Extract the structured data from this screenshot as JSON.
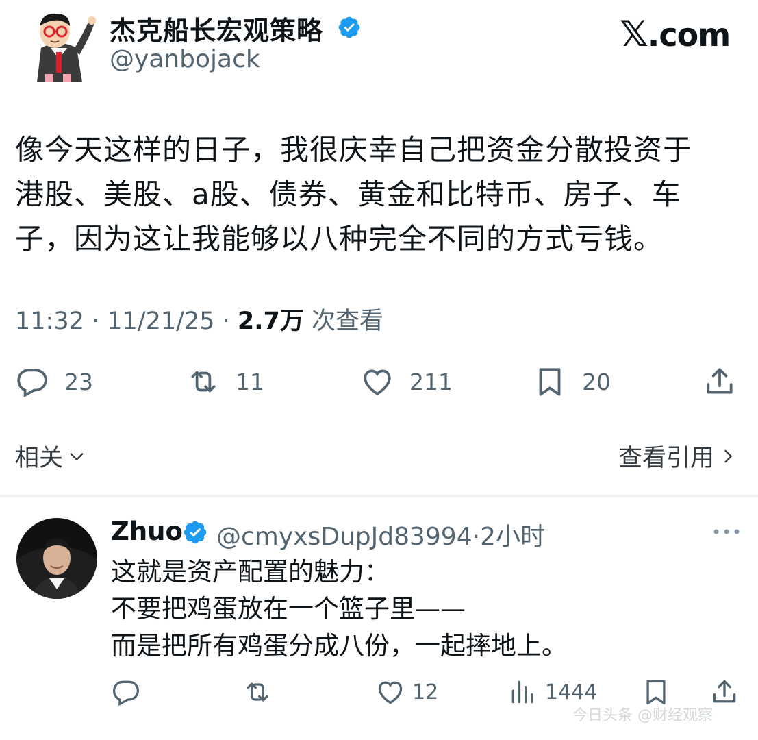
{
  "tweet": {
    "author_name": "杰克船长宏观策略",
    "author_handle": "@yanbojack",
    "source_logo_mark": "𝕏",
    "source_logo_text": ".com",
    "body_lines": [
      "像今天这样的日子，我很庆幸自己把资金分散投资于",
      "港股、美股、a股、债券、黄金和比特币、房子、车",
      "子，因为这让我能够以八种完全不同的方式亏钱。"
    ],
    "time": "11:32",
    "date": "11/21/25",
    "views_count": "2.7万",
    "views_label": "次查看",
    "meta_sep": " · ",
    "actions": {
      "replies": "23",
      "retweets": "11",
      "likes": "211",
      "bookmarks": "20"
    },
    "related_label": "相关",
    "quotes_label": "查看引用"
  },
  "reply": {
    "author_name": "Zhuo",
    "author_handle": "@cmyxsDupJd83994",
    "time_ago": "2小时",
    "meta_sep": "·",
    "body_lines": [
      "这就是资产配置的魅力：",
      "不要把鸡蛋放在一个篮子里——",
      "而是把所有鸡蛋分成八份，一起摔地上。"
    ],
    "actions": {
      "likes": "12",
      "views": "1444"
    }
  },
  "watermark": "今日头条 @财经观察",
  "icons": {
    "verified": "verified-badge-icon",
    "reply": "reply-bubble-icon",
    "retweet": "retweet-arrows-icon",
    "like": "heart-icon",
    "bookmark": "bookmark-icon",
    "share": "share-upload-icon",
    "views": "bar-chart-icon",
    "more": "ellipsis-icon",
    "chevron_down": "chevron-down-icon",
    "chevron_right": "chevron-right-icon"
  },
  "colors": {
    "text": "#0f1419",
    "muted": "#536471",
    "verified": "#1d9bf0",
    "divider": "#eff3f4"
  }
}
